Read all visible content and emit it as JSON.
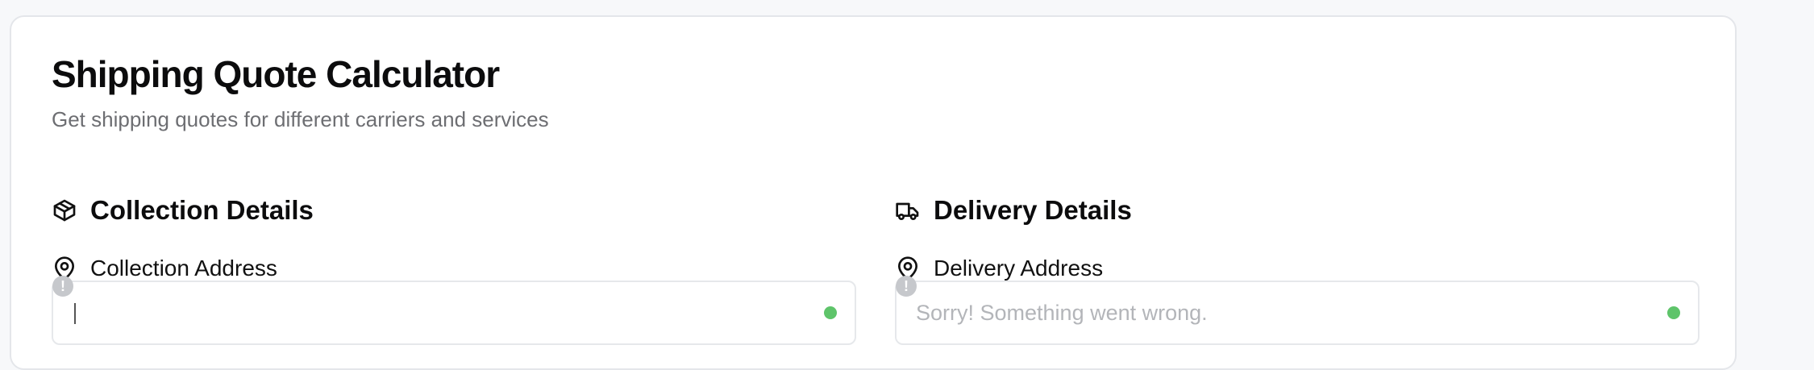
{
  "header": {
    "title": "Shipping Quote Calculator",
    "subtitle": "Get shipping quotes for different carriers and services"
  },
  "collection": {
    "section_title": "Collection Details",
    "section_icon": "package-icon",
    "address_label": "Collection Address",
    "address_icon": "map-pin-icon",
    "address_value": "",
    "address_placeholder": "",
    "warning_glyph": "!",
    "status_color": "#5ec46a"
  },
  "delivery": {
    "section_title": "Delivery Details",
    "section_icon": "truck-icon",
    "address_label": "Delivery Address",
    "address_icon": "map-pin-icon",
    "address_value": "",
    "address_placeholder": "Sorry! Something went wrong.",
    "warning_glyph": "!",
    "status_color": "#5ec46a"
  },
  "colors": {
    "background": "#f7f8fa",
    "card": "#ffffff",
    "border": "#e4e6ea",
    "muted_text": "#6d6e72",
    "status_ok": "#5ec46a"
  }
}
